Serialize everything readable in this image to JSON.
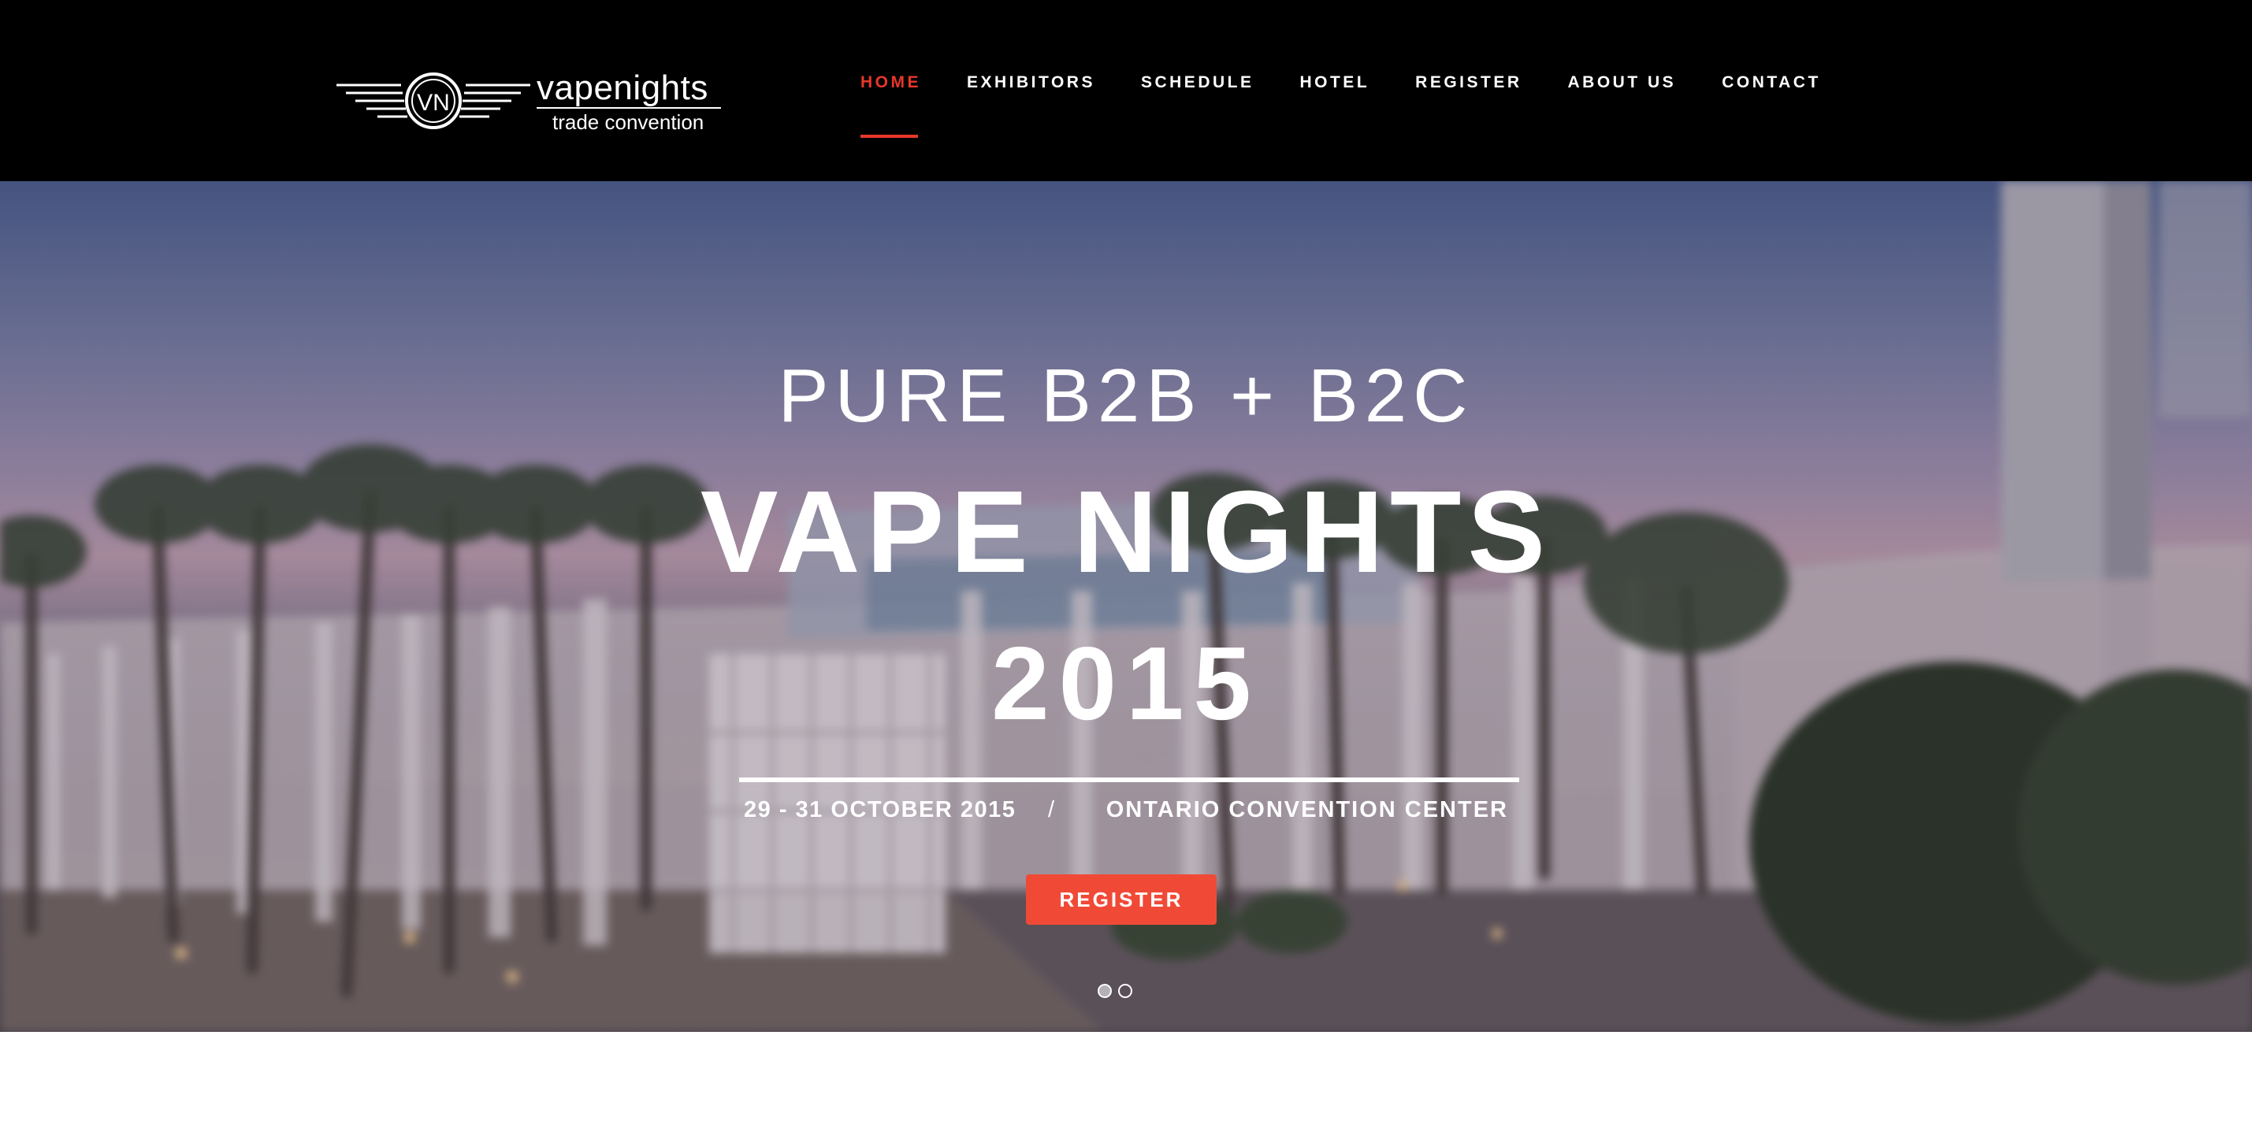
{
  "brand": {
    "name": "vapenights",
    "tagline": "trade convention",
    "monogram": "VN"
  },
  "nav": {
    "items": [
      {
        "label": "HOME",
        "active": true
      },
      {
        "label": "EXHIBITORS",
        "active": false
      },
      {
        "label": "SCHEDULE",
        "active": false
      },
      {
        "label": "HOTEL",
        "active": false
      },
      {
        "label": "REGISTER",
        "active": false
      },
      {
        "label": "ABOUT US",
        "active": false
      },
      {
        "label": "CONTACT",
        "active": false
      }
    ]
  },
  "hero": {
    "eyebrow": "PURE B2B + B2C",
    "title": "VAPE NIGHTS",
    "year": "2015",
    "date": "29 - 31 OCTOBER 2015",
    "separator": "/",
    "venue": "ONTARIO CONVENTION CENTER",
    "cta_label": "REGISTER",
    "slides": {
      "count": 2,
      "active_index": 0
    }
  },
  "colors": {
    "header_bg": "#000000",
    "accent": "#e8372b",
    "button": "#f04a37",
    "text": "#ffffff",
    "page_bg": "#ffffff"
  },
  "icons": {
    "logo": "winged-circle-logo-icon",
    "slide_dots": "carousel-dot-icon"
  }
}
